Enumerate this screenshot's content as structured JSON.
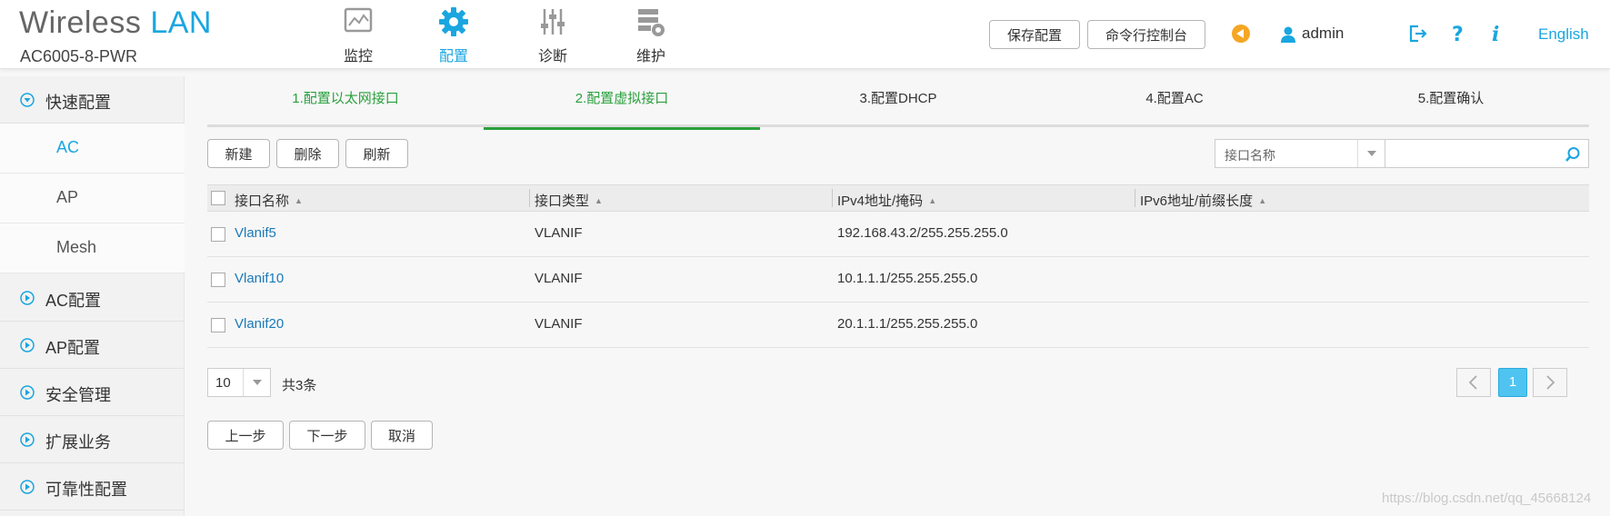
{
  "brand": {
    "title_part1": "Wireless",
    "title_part2": "LAN",
    "model": "AC6005-8-PWR"
  },
  "nav": [
    {
      "label": "监控",
      "icon": "monitor-icon"
    },
    {
      "label": "配置",
      "icon": "gear-icon",
      "active": true
    },
    {
      "label": "诊断",
      "icon": "sliders-icon"
    },
    {
      "label": "维护",
      "icon": "maintenance-icon"
    }
  ],
  "header_buttons": {
    "save": "保存配置",
    "cli": "命令行控制台"
  },
  "user": {
    "name": "admin"
  },
  "language": "English",
  "sidebar": {
    "quick_config": "快速配置",
    "sub_items": [
      "AC",
      "AP",
      "Mesh"
    ],
    "active_sub": "AC",
    "sections": [
      "AC配置",
      "AP配置",
      "安全管理",
      "扩展业务",
      "可靠性配置"
    ]
  },
  "steps": [
    {
      "label": "1.配置以太网接口",
      "state": "done"
    },
    {
      "label": "2.配置虚拟接口",
      "state": "active"
    },
    {
      "label": "3.配置DHCP",
      "state": "pending"
    },
    {
      "label": "4.配置AC",
      "state": "pending"
    },
    {
      "label": "5.配置确认",
      "state": "pending"
    }
  ],
  "toolbar": {
    "new": "新建",
    "delete": "删除",
    "refresh": "刷新"
  },
  "filter": {
    "field": "接口名称",
    "placeholder": ""
  },
  "table": {
    "headers": [
      "接口名称",
      "接口类型",
      "IPv4地址/掩码",
      "IPv6地址/前缀长度"
    ],
    "rows": [
      {
        "name": "Vlanif5",
        "type": "VLANIF",
        "ipv4": "192.168.43.2/255.255.255.0",
        "ipv6": ""
      },
      {
        "name": "Vlanif10",
        "type": "VLANIF",
        "ipv4": "10.1.1.1/255.255.255.0",
        "ipv6": ""
      },
      {
        "name": "Vlanif20",
        "type": "VLANIF",
        "ipv4": "20.1.1.1/255.255.255.0",
        "ipv6": ""
      }
    ]
  },
  "pagination": {
    "page_size": "10",
    "total": "共3条",
    "current": "1"
  },
  "footer_buttons": {
    "prev": "上一步",
    "next": "下一步",
    "cancel": "取消"
  },
  "watermark": "https://blog.csdn.net/qq_45668124",
  "colors": {
    "accent": "#1aa6e0",
    "step_active": "#2aa03d",
    "link": "#1a7ab8",
    "page_current": "#4fc4f0"
  }
}
